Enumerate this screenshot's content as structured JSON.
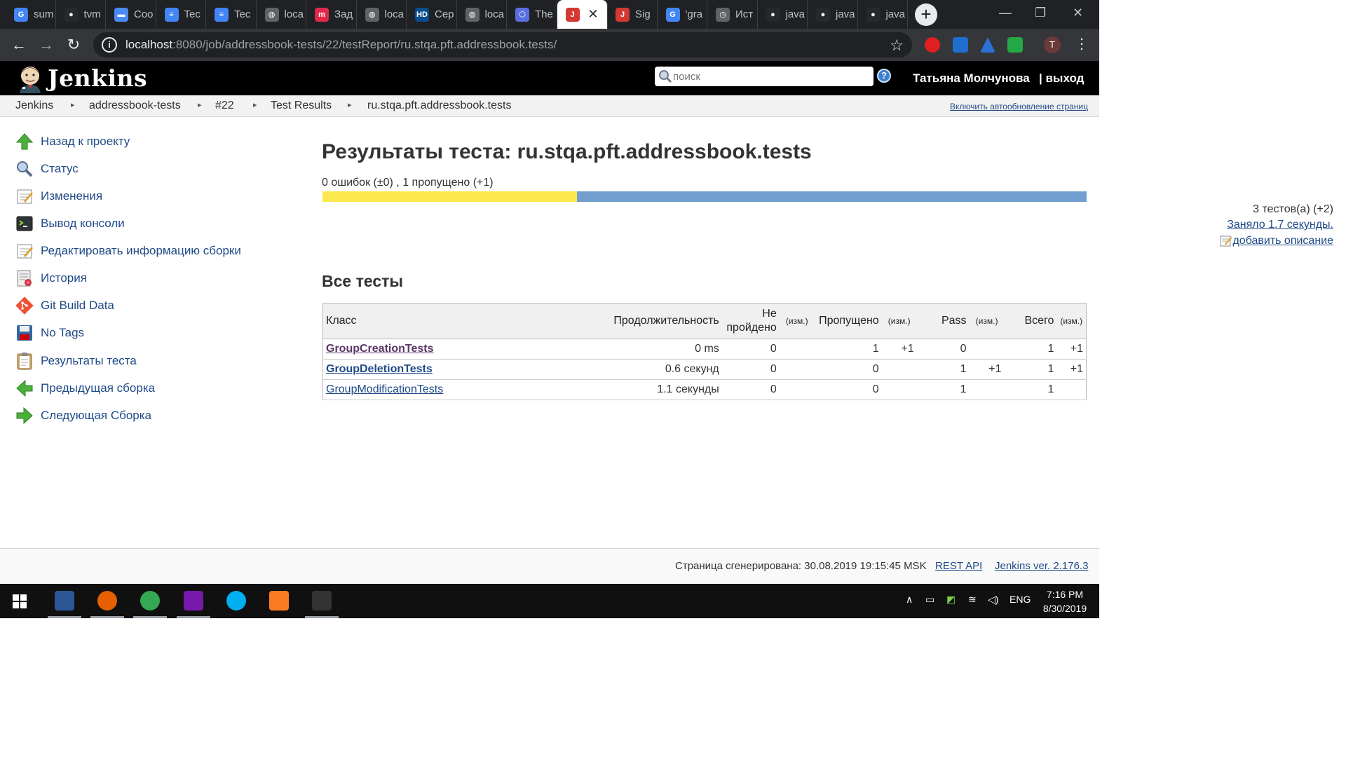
{
  "browser": {
    "tabs": [
      {
        "title": "sum",
        "icon": "google-icon",
        "color": "#4285f4",
        "glyph": "G"
      },
      {
        "title": "tvm",
        "icon": "github-icon",
        "color": "#24292e",
        "glyph": "●"
      },
      {
        "title": "Coo",
        "icon": "chat-icon",
        "color": "#4a8af4",
        "glyph": "▬"
      },
      {
        "title": "Tec",
        "icon": "docs-icon",
        "color": "#4285f4",
        "glyph": "≡"
      },
      {
        "title": "Tec",
        "icon": "docs-icon",
        "color": "#4285f4",
        "glyph": "≡"
      },
      {
        "title": "loca",
        "icon": "globe-icon",
        "color": "#5f6368",
        "glyph": "◍"
      },
      {
        "title": "Зад",
        "icon": "tasks-icon",
        "color": "#e0284a",
        "glyph": "m"
      },
      {
        "title": "loca",
        "icon": "globe-icon",
        "color": "#5f6368",
        "glyph": "◍"
      },
      {
        "title": "Сер",
        "icon": "hd-icon",
        "color": "#0a4d8c",
        "glyph": "HD"
      },
      {
        "title": "loca",
        "icon": "globe-icon",
        "color": "#5f6368",
        "glyph": "◍"
      },
      {
        "title": "The",
        "icon": "hexagon-icon",
        "color": "#5b6ee1",
        "glyph": "⬡"
      },
      {
        "title": "",
        "icon": "jenkins-icon",
        "color": "#d33833",
        "glyph": "J",
        "active": true
      },
      {
        "title": "Sig",
        "icon": "jenkins-icon",
        "color": "#d33833",
        "glyph": "J"
      },
      {
        "title": "'gra",
        "icon": "google-icon",
        "color": "#4285f4",
        "glyph": "G"
      },
      {
        "title": "Ист",
        "icon": "history-icon",
        "color": "#5f6368",
        "glyph": "◷"
      },
      {
        "title": "java",
        "icon": "github-icon",
        "color": "#24292e",
        "glyph": "●"
      },
      {
        "title": "java",
        "icon": "github-icon",
        "color": "#24292e",
        "glyph": "●"
      },
      {
        "title": "java",
        "icon": "github-icon",
        "color": "#24292e",
        "glyph": "●"
      }
    ],
    "url_host": "localhost",
    "url_path": ":8080/job/addressbook-tests/22/testReport/ru.stqa.pft.addressbook.tests/"
  },
  "jenkins": {
    "title": "Jenkins",
    "search_placeholder": "поиск",
    "help": "?",
    "user": "Татьяна Молчунова",
    "logout": "| выход"
  },
  "breadcrumbs": [
    "Jenkins",
    "addressbook-tests",
    "#22",
    "Test Results",
    "ru.stqa.pft.addressbook.tests"
  ],
  "autorefresh": "Включить автообновление страниц",
  "sidebar": [
    {
      "label": "Назад к проекту",
      "icon": "up-arrow-icon"
    },
    {
      "label": "Статус",
      "icon": "magnifier-icon"
    },
    {
      "label": "Изменения",
      "icon": "notepad-icon"
    },
    {
      "label": "Вывод консоли",
      "icon": "terminal-icon"
    },
    {
      "label": "Редактировать информацию сборки",
      "icon": "notepad-icon"
    },
    {
      "label": "История",
      "icon": "history-icon"
    },
    {
      "label": "Git Build Data",
      "icon": "git-icon"
    },
    {
      "label": "No Tags",
      "icon": "save-icon"
    },
    {
      "label": "Результаты теста",
      "icon": "clipboard-icon"
    },
    {
      "label": "Предыдущая сборка",
      "icon": "left-arrow-icon"
    },
    {
      "label": "Следующая Сборка",
      "icon": "right-arrow-icon"
    }
  ],
  "main": {
    "title": "Результаты теста: ru.stqa.pft.addressbook.tests",
    "summary": "0 ошибок (±0) , 1 пропущено (+1)",
    "bar": {
      "skipped_fraction": 0.3333,
      "skip_color": "#fce94f",
      "pass_color": "#729fcf"
    },
    "tests_total": "3 тестов(а) (+2)",
    "duration_link": "Заняло 1.7 секунды.",
    "add_description": "добавить описание",
    "all_tests_heading": "Все тесты",
    "table": {
      "headers": {
        "class": "Класс",
        "duration": "Продолжительность",
        "failed_1": "Не",
        "failed_2": "пройдено",
        "diff1": "(изм.)",
        "skipped": "Пропущено",
        "diff2": "(изм.)",
        "pass": "Pass",
        "diff3": "(изм.)",
        "total": "Всего",
        "diff4": "(изм.)"
      },
      "rows": [
        {
          "name": "GroupCreationTests",
          "duration": "0 ms",
          "failed": "0",
          "failed_diff": "",
          "skipped": "1",
          "skipped_diff": "+1",
          "pass": "0",
          "pass_diff": "",
          "total": "1",
          "total_diff": "+1"
        },
        {
          "name": "GroupDeletionTests",
          "duration": "0.6 секунд",
          "failed": "0",
          "failed_diff": "",
          "skipped": "0",
          "skipped_diff": "",
          "pass": "1",
          "pass_diff": "+1",
          "total": "1",
          "total_diff": "+1"
        },
        {
          "name": "GroupModificationTests",
          "duration": "1.1 секунды",
          "failed": "0",
          "failed_diff": "",
          "skipped": "0",
          "skipped_diff": "",
          "pass": "1",
          "pass_diff": "",
          "total": "1",
          "total_diff": ""
        }
      ]
    }
  },
  "footer": {
    "generated": "Страница сгенерирована: 30.08.2019 19:15:45 MSK",
    "rest_api": "REST API",
    "version": "Jenkins ver. 2.176.3"
  },
  "taskbar": {
    "apps": [
      {
        "icon": "save-icon",
        "color": "#2b5797"
      },
      {
        "icon": "firefox-icon",
        "color": "#e66000"
      },
      {
        "icon": "chrome-icon",
        "color": "#34a853"
      },
      {
        "icon": "onenote-icon",
        "color": "#7719aa"
      },
      {
        "icon": "skype-icon",
        "color": "#00aff0"
      },
      {
        "icon": "xampp-icon",
        "color": "#fb7a24"
      },
      {
        "icon": "cmd-icon",
        "color": "#333333"
      }
    ],
    "lang": "ENG",
    "time": "7:16 PM",
    "date": "8/30/2019"
  }
}
